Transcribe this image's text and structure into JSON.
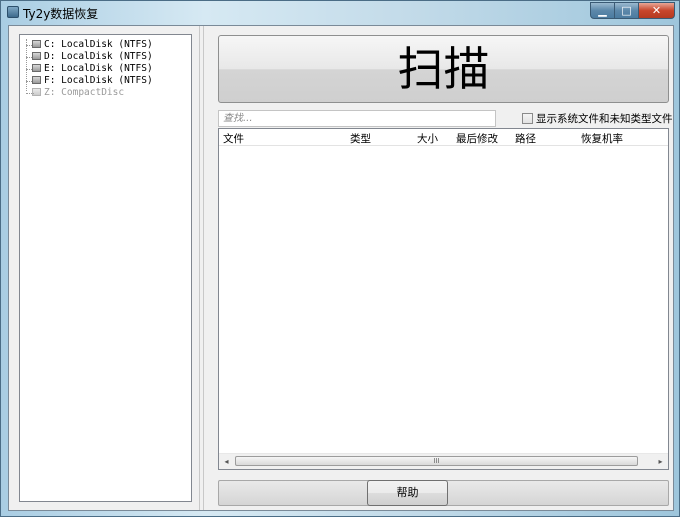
{
  "window": {
    "title": "Ty2y数据恢复",
    "controls": {
      "minimize": "▁",
      "maximize": "□",
      "close": "✕"
    }
  },
  "tree": {
    "items": [
      {
        "label": "C: LocalDisk (NTFS)",
        "enabled": true
      },
      {
        "label": "D: LocalDisk (NTFS)",
        "enabled": true
      },
      {
        "label": "E: LocalDisk (NTFS)",
        "enabled": true
      },
      {
        "label": "F: LocalDisk (NTFS)",
        "enabled": true
      },
      {
        "label": "Z: CompactDisc",
        "enabled": false
      }
    ]
  },
  "scan_button": {
    "label": "扫描"
  },
  "search": {
    "placeholder": "查找..."
  },
  "show_system_files": {
    "label": "显示系统文件和未知类型文件",
    "checked": false
  },
  "file_list": {
    "columns": [
      "文件",
      "类型",
      "大小",
      "最后修改",
      "路径",
      "恢复机率"
    ],
    "rows": []
  },
  "scrollbar": {
    "left_arrow": "◂",
    "right_arrow": "▸",
    "grip": "III"
  },
  "help_button": {
    "label": "帮助"
  }
}
